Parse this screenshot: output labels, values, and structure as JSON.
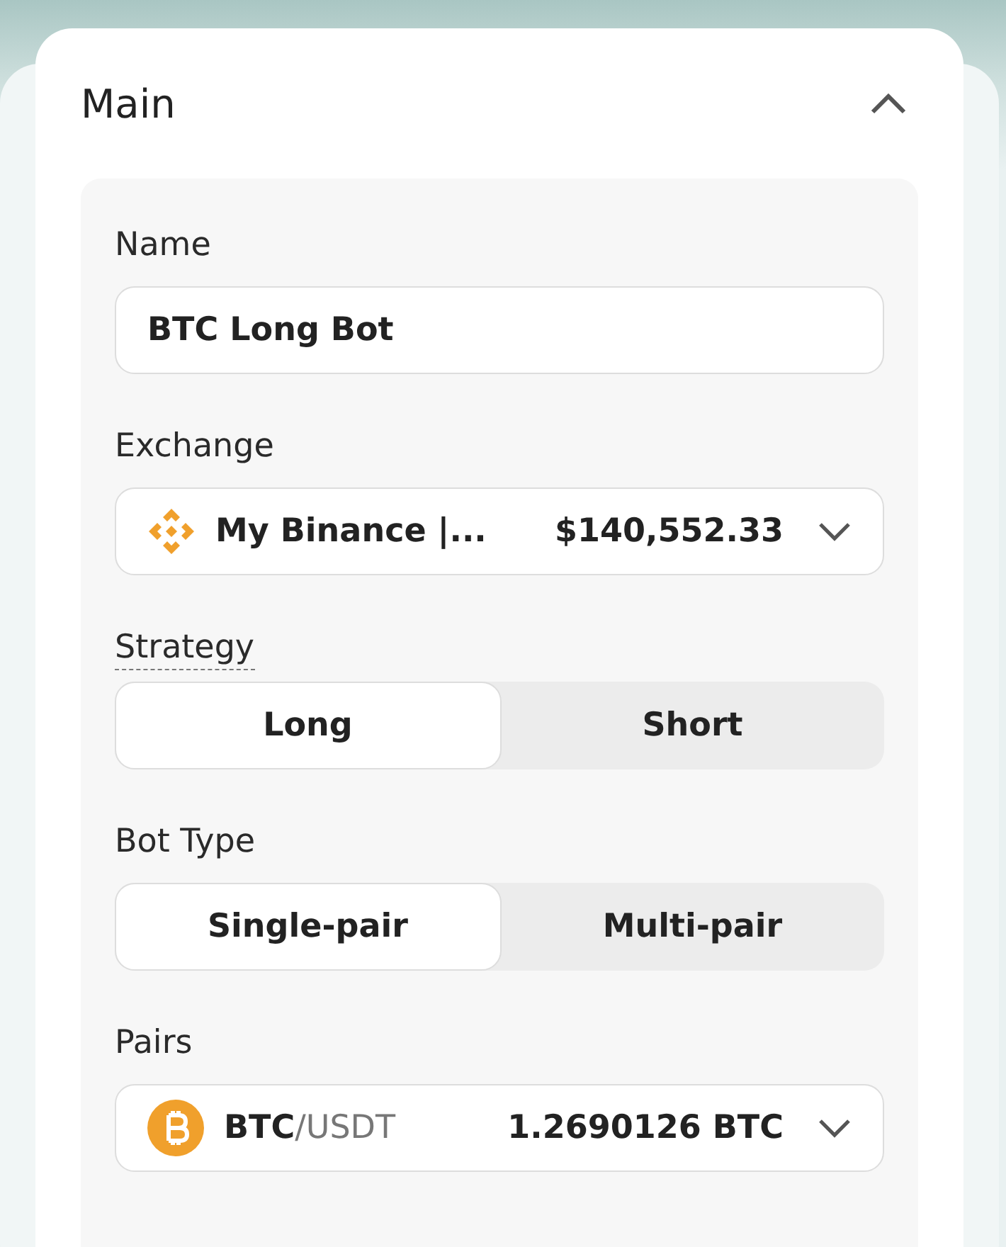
{
  "section": {
    "title": "Main",
    "expanded": true
  },
  "name_field": {
    "label": "Name",
    "value": "BTC Long Bot"
  },
  "exchange": {
    "label": "Exchange",
    "account": "My Binance |...",
    "balance": "$140,552.33"
  },
  "strategy": {
    "label": "Strategy",
    "options": [
      {
        "label": "Long",
        "selected": true
      },
      {
        "label": "Short",
        "selected": false
      }
    ]
  },
  "bot_type": {
    "label": "Bot Type",
    "options": [
      {
        "label": "Single-pair",
        "selected": true
      },
      {
        "label": "Multi-pair",
        "selected": false
      }
    ]
  },
  "pairs": {
    "label": "Pairs",
    "base": "BTC",
    "quote": "/USDT",
    "amount": "1.2690126 BTC"
  }
}
